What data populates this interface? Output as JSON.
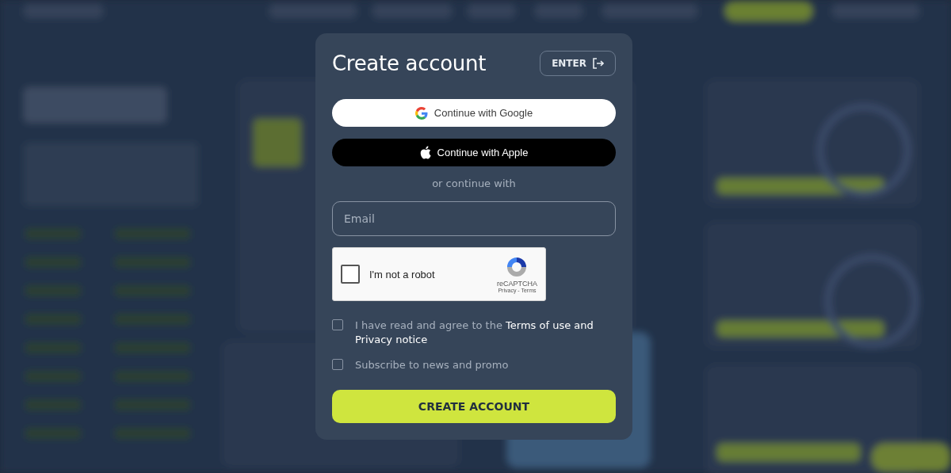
{
  "dialog": {
    "title": "Create account",
    "enter_button": "ENTER",
    "social_buttons": [
      {
        "kind": "google",
        "label": "Continue with Google"
      },
      {
        "kind": "apple",
        "label": "Continue with Apple"
      }
    ],
    "divider_text": "or continue with",
    "email": {
      "placeholder": "Email"
    },
    "captcha": {
      "label": "I'm not a robot",
      "checked": false,
      "brand": "reCAPTCHA",
      "links": "Privacy - Terms"
    },
    "agreements": [
      {
        "text": "I have read and agree to the **Terms of use and Privacy notice**",
        "checked": false
      },
      {
        "text": "Subscribe to news and promo",
        "checked": false
      }
    ],
    "submit": "CREATE ACCOUNT"
  }
}
